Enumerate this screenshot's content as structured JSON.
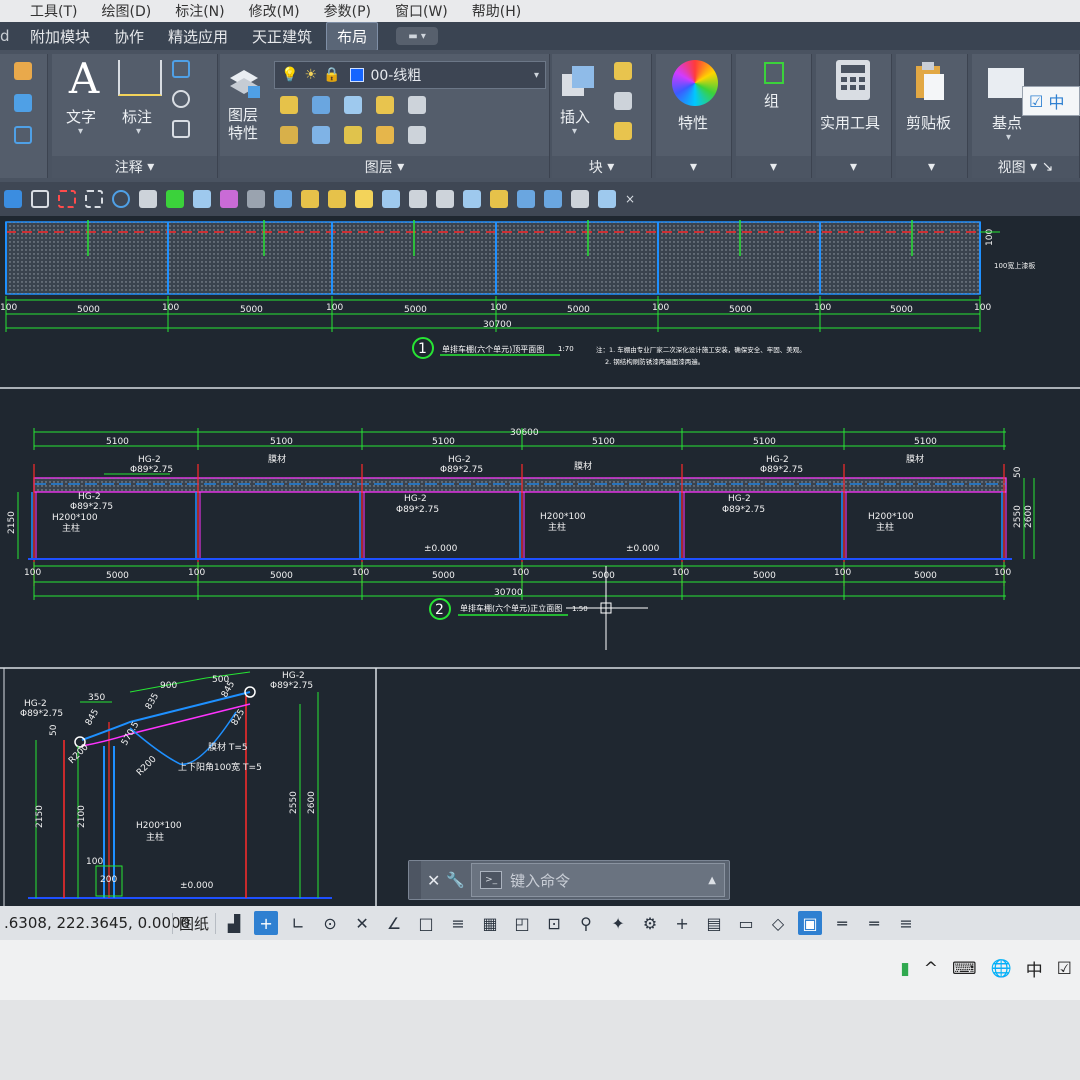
{
  "menu": [
    "工具(T)",
    "绘图(D)",
    "标注(N)",
    "修改(M)",
    "参数(P)",
    "窗口(W)",
    "帮助(H)"
  ],
  "tabs": [
    {
      "label": "附加模块",
      "active": false
    },
    {
      "label": "协作",
      "active": false
    },
    {
      "label": "精选应用",
      "active": false
    },
    {
      "label": "天正建筑",
      "active": false
    },
    {
      "label": "布局",
      "active": true
    }
  ],
  "ribbon": {
    "text_label": "文字",
    "dim_label": "标注",
    "annotation_panel": "注释",
    "layer_props_label": "图层\n特性",
    "layer_combo_value": "00-线粗",
    "layer_panel": "图层",
    "insert_label": "插入",
    "block_panel": "块",
    "properties_label": "特性",
    "group_label": "组",
    "utilities_label": "实用工具",
    "clipboard_label": "剪贴板",
    "basepoint_label": "基点",
    "view_panel": "视图",
    "lang_badge": "中"
  },
  "drawing": {
    "plan": {
      "spans": [
        "5000",
        "5000",
        "5000",
        "5000",
        "5000",
        "5000"
      ],
      "posts": [
        "100",
        "100",
        "100",
        "100",
        "100",
        "100",
        "100"
      ],
      "total": "30700",
      "right_label": "100宽上漆板",
      "right_dim": "100",
      "title_num": "1",
      "title": "单排车棚(六个单元)顶平面图",
      "scale": "1:70",
      "note1": "注：1. 车棚由专业厂家二次深化设计施工安装，确保安全、牢固、美观。",
      "note2": "2. 钢结构刷防锈漆两遍面漆两遍。"
    },
    "elevation": {
      "total_top": "30600",
      "spans_top": [
        "5100",
        "5100",
        "5100",
        "5100",
        "5100",
        "5100"
      ],
      "spans_bottom": [
        "5000",
        "5000",
        "5000",
        "5000",
        "5000",
        "5000"
      ],
      "posts": [
        "100",
        "100",
        "100",
        "100",
        "100",
        "100",
        "100"
      ],
      "total_bottom": "30700",
      "pipe_tag": "HG-2",
      "pipe_size": "Φ89*2.75",
      "column_tag": "H200*100",
      "column_note": "主柱",
      "roof_note": "膜材",
      "level": "±0.000",
      "height_left": "2150",
      "height_right_1": "2550",
      "height_right_2": "2600",
      "top_dim": "50",
      "title_num": "2",
      "title": "单排车棚(六个单元)正立面图",
      "scale": "1:50"
    },
    "section": {
      "pipe_tag": "HG-2",
      "pipe_size": "Φ89*2.75",
      "column_tag": "H200*100",
      "column_note": "主柱",
      "dims_top": [
        "350",
        "900",
        "500"
      ],
      "dims_angle": [
        "845",
        "835",
        "845",
        "825"
      ],
      "dim_r": "R200",
      "dim_r2": "R200",
      "dim_sub": "570.5",
      "roof_note1": "膜材 T=5",
      "roof_note2": "上下阳角100宽 T=5",
      "h1": "2150",
      "h2": "2100",
      "h3": "2550",
      "h4": "2600",
      "top": "50",
      "base": "100",
      "base_w": "200",
      "level": "±0.000"
    }
  },
  "command": {
    "placeholder": "键入命令"
  },
  "status": {
    "coords": ".6308, 222.3645, 0.0000",
    "paper": "图纸"
  },
  "tray": {
    "ime": "中"
  },
  "colors": {
    "canvas_bg": "#1f2730",
    "dim_green": "#27e534",
    "column_blue": "#1e90ff",
    "axis_red": "#ff2b2b",
    "roof_magenta": "#ff33ff"
  }
}
